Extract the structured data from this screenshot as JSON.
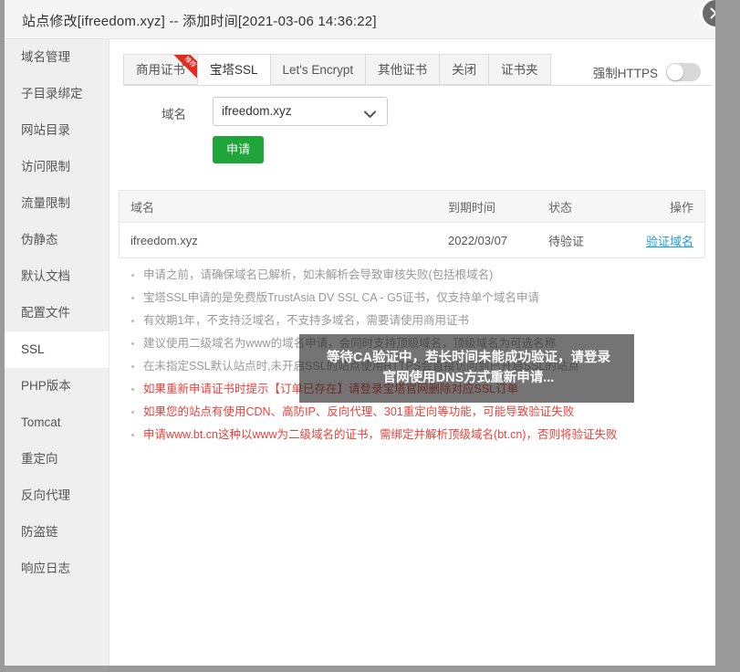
{
  "window": {
    "title": "站点修改[ifreedom.xyz] -- 添加时间[2021-03-06 14:36:22]",
    "close_icon": "close-icon"
  },
  "sidebar": {
    "items": [
      {
        "label": "域名管理",
        "active": false
      },
      {
        "label": "子目录绑定",
        "active": false
      },
      {
        "label": "网站目录",
        "active": false
      },
      {
        "label": "访问限制",
        "active": false
      },
      {
        "label": "流量限制",
        "active": false
      },
      {
        "label": "伪静态",
        "active": false
      },
      {
        "label": "默认文档",
        "active": false
      },
      {
        "label": "配置文件",
        "active": false
      },
      {
        "label": "SSL",
        "active": true
      },
      {
        "label": "PHP版本",
        "active": false
      },
      {
        "label": "Tomcat",
        "active": false
      },
      {
        "label": "重定向",
        "active": false
      },
      {
        "label": "反向代理",
        "active": false
      },
      {
        "label": "防盗链",
        "active": false
      },
      {
        "label": "响应日志",
        "active": false
      }
    ]
  },
  "tabs": [
    {
      "label": "商用证书",
      "active": false,
      "ribbon": "推荐"
    },
    {
      "label": "宝塔SSL",
      "active": true,
      "ribbon": ""
    },
    {
      "label": "Let's Encrypt",
      "active": false,
      "ribbon": ""
    },
    {
      "label": "其他证书",
      "active": false,
      "ribbon": ""
    },
    {
      "label": "关闭",
      "active": false,
      "ribbon": ""
    },
    {
      "label": "证书夹",
      "active": false,
      "ribbon": ""
    }
  ],
  "force_https": {
    "label": "强制HTTPS",
    "enabled": false
  },
  "form": {
    "domain_label": "域名",
    "domain_value": "ifreedom.xyz",
    "domain_options": [
      "ifreedom.xyz"
    ],
    "apply_label": "申请",
    "apply_color": "#20a53a",
    "caret_icon": "chevron-down-icon"
  },
  "table": {
    "headers": {
      "domain": "域名",
      "expire": "到期时间",
      "status": "状态",
      "action": "操作"
    },
    "rows": [
      {
        "domain": "ifreedom.xyz",
        "expire": "2022/03/07",
        "status": "待验证",
        "action": "验证域名"
      }
    ]
  },
  "notes": [
    {
      "text": "申请之前，请确保域名已解析，如未解析会导致审核失败(包括根域名)",
      "warn": false
    },
    {
      "text": "宝塔SSL申请的是免费版TrustAsia DV SSL CA - G5证书，仅支持单个域名申请",
      "warn": false
    },
    {
      "text": "有效期1年，不支持泛域名，不支持多域名，需要请使用商用证书",
      "warn": false
    },
    {
      "text": "建议使用二级域名为www的域名申请，会同时支持顶级域名，顶级域名为可选名称",
      "warn": false
    },
    {
      "text": "在未指定SSL默认站点时,未开启SSL的站点使用HTTPS会直接访问到已开启SSL的站点",
      "warn": false
    },
    {
      "text": "如果重新申请证书时提示【订单已存在】请登录宝塔官网删除对应SSL订单",
      "warn": true
    },
    {
      "text": "如果您的站点有使用CDN、高防IP、反向代理、301重定向等功能，可能导致验证失败",
      "warn": true
    },
    {
      "text": "申请www.bt.cn这种以www为二级域名的证书，需绑定并解析顶级域名(bt.cn)，否则将验证失败",
      "warn": true
    }
  ],
  "toast": {
    "line1": "等待CA验证中，若长时间未能成功验证，请登录",
    "line2": "官网使用DNS方式重新申请..."
  }
}
